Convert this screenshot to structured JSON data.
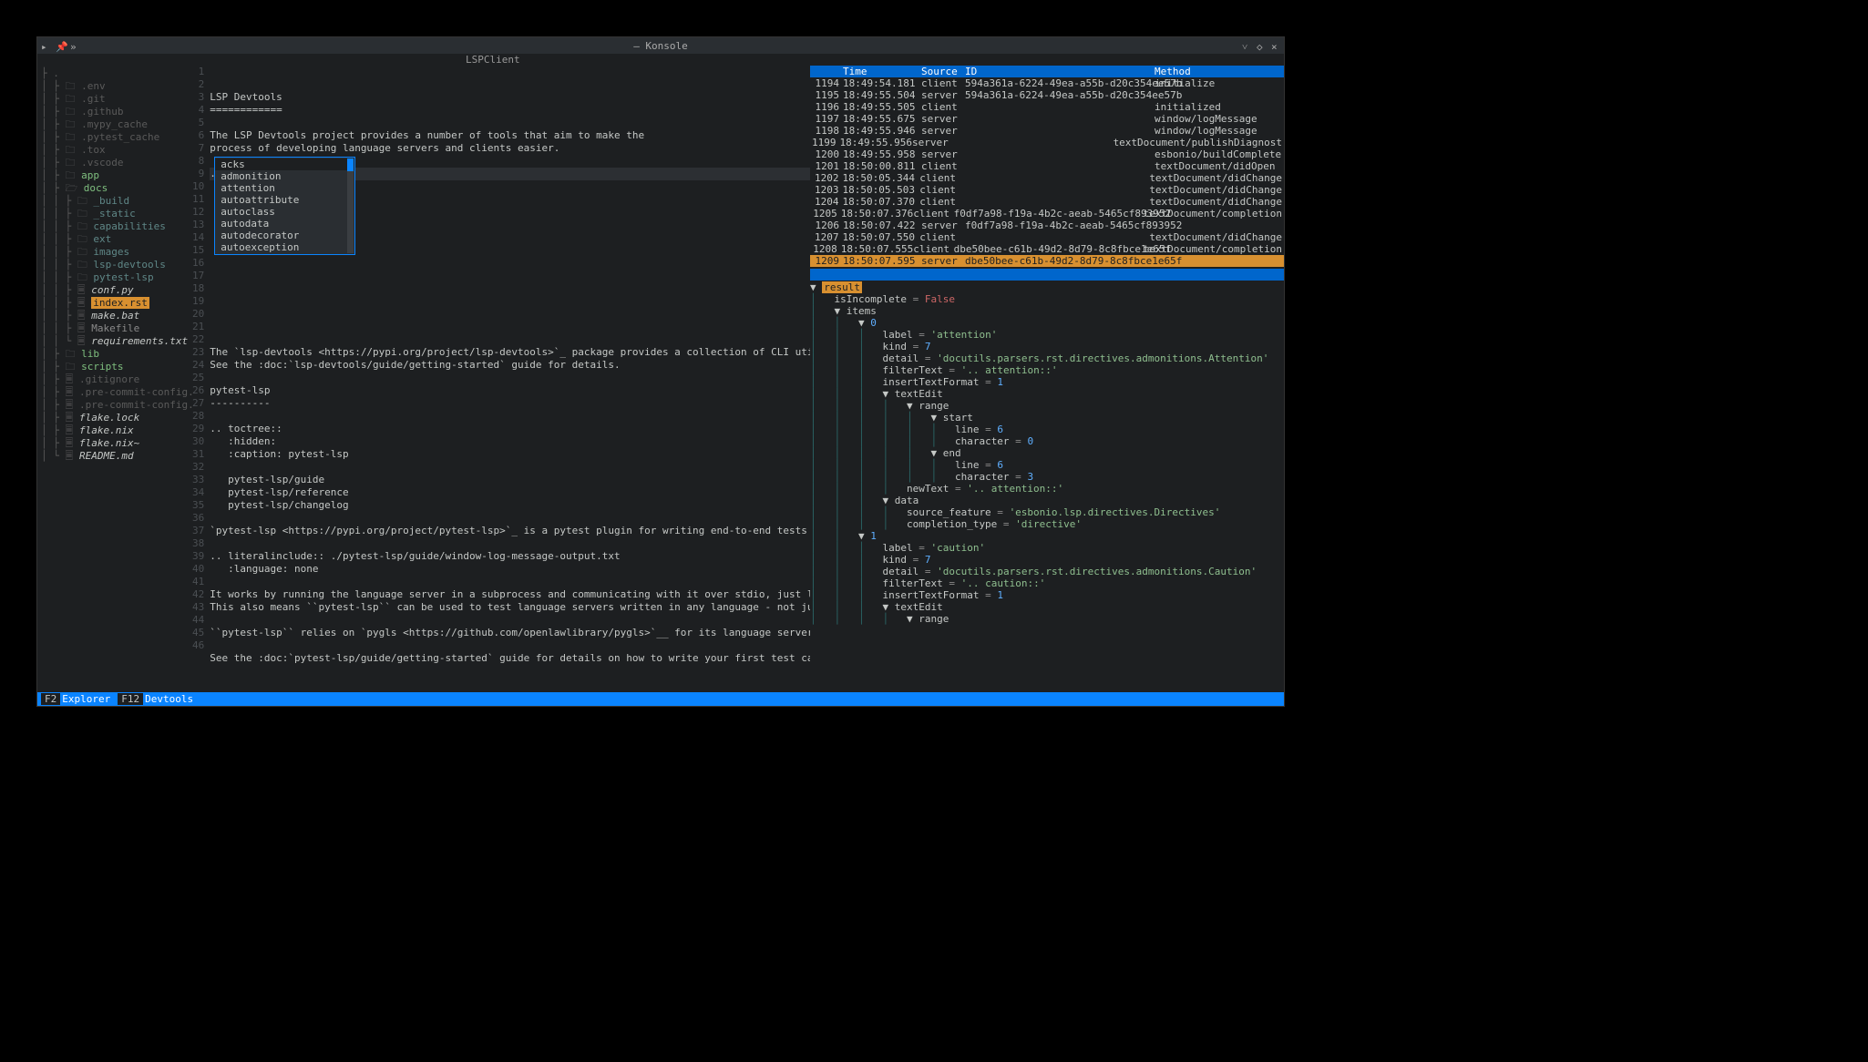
{
  "window": {
    "title": "— Konsole"
  },
  "tab": {
    "title": "LSPClient"
  },
  "sidebar": {
    "rows": [
      {
        "prefix": "├ ",
        "icon": "",
        "name": ".",
        "cls": "dim"
      },
      {
        "prefix": "│ ├ ",
        "icon": "🗀 ",
        "name": ".env",
        "cls": "dim"
      },
      {
        "prefix": "│ ├ ",
        "icon": "🗀 ",
        "name": ".git",
        "cls": "dim"
      },
      {
        "prefix": "│ ├ ",
        "icon": "🗀 ",
        "name": ".github",
        "cls": "dim"
      },
      {
        "prefix": "│ ├ ",
        "icon": "🗀 ",
        "name": ".mypy_cache",
        "cls": "dim"
      },
      {
        "prefix": "│ ├ ",
        "icon": "🗀 ",
        "name": ".pytest_cache",
        "cls": "dim"
      },
      {
        "prefix": "│ ├ ",
        "icon": "🗀 ",
        "name": ".tox",
        "cls": "dim"
      },
      {
        "prefix": "│ ├ ",
        "icon": "🗀 ",
        "name": ".vscode",
        "cls": "dim"
      },
      {
        "prefix": "│ ├ ",
        "icon": "🗀 ",
        "name": "app",
        "cls": "fg-green"
      },
      {
        "prefix": "│ ├ ",
        "icon": "🗁 ",
        "name": "docs",
        "cls": "fg-green"
      },
      {
        "prefix": "│ │ ├ ",
        "icon": "🗀 ",
        "name": "_build",
        "cls": "fg-cyan"
      },
      {
        "prefix": "│ │ ├ ",
        "icon": "🗀 ",
        "name": "_static",
        "cls": "fg-cyan"
      },
      {
        "prefix": "│ │ ├ ",
        "icon": "🗀 ",
        "name": "capabilities",
        "cls": "fg-cyan"
      },
      {
        "prefix": "│ │ ├ ",
        "icon": "🗀 ",
        "name": "ext",
        "cls": "fg-cyan"
      },
      {
        "prefix": "│ │ ├ ",
        "icon": "🗀 ",
        "name": "images",
        "cls": "fg-cyan"
      },
      {
        "prefix": "│ │ ├ ",
        "icon": "🗀 ",
        "name": "lsp-devtools",
        "cls": "fg-cyan"
      },
      {
        "prefix": "│ │ ├ ",
        "icon": "🗀 ",
        "name": "pytest-lsp",
        "cls": "fg-cyan"
      },
      {
        "prefix": "│ │ ├ ",
        "icon": "🗏 ",
        "name": "conf.py",
        "cls": "fg-emph"
      },
      {
        "prefix": "│ │ ├ ",
        "icon": "🗏 ",
        "name": "index.rst",
        "cls": "selected"
      },
      {
        "prefix": "│ │ ├ ",
        "icon": "🗏 ",
        "name": "make.bat",
        "cls": "fg-emph"
      },
      {
        "prefix": "│ │ ├ ",
        "icon": "🗏 ",
        "name": "Makefile",
        "cls": ""
      },
      {
        "prefix": "│ │ └ ",
        "icon": "🗏 ",
        "name": "requirements.txt",
        "cls": "fg-emph"
      },
      {
        "prefix": "│ ├ ",
        "icon": "🗀 ",
        "name": "lib",
        "cls": "fg-green"
      },
      {
        "prefix": "│ ├ ",
        "icon": "🗀 ",
        "name": "scripts",
        "cls": "fg-green"
      },
      {
        "prefix": "│ ├ ",
        "icon": "🗏 ",
        "name": ".gitignore",
        "cls": "dim"
      },
      {
        "prefix": "│ ├ ",
        "icon": "🗏 ",
        "name": ".pre-commit-config.yaml",
        "cls": "dim"
      },
      {
        "prefix": "│ ├ ",
        "icon": "🗏 ",
        "name": ".pre-commit-config.yaml",
        "cls": "dim"
      },
      {
        "prefix": "│ ├ ",
        "icon": "🗏 ",
        "name": "flake.lock",
        "cls": "fg-emph"
      },
      {
        "prefix": "│ ├ ",
        "icon": "🗏 ",
        "name": "flake.nix",
        "cls": "fg-emph"
      },
      {
        "prefix": "│ ├ ",
        "icon": "🗏 ",
        "name": "flake.nix~",
        "cls": "fg-emph"
      },
      {
        "prefix": "│ └ ",
        "icon": "🗏 ",
        "name": "README.md",
        "cls": "fg-emph"
      }
    ]
  },
  "editor": {
    "lines": [
      {
        "n": 1,
        "t": "LSP Devtools"
      },
      {
        "n": 2,
        "t": "============"
      },
      {
        "n": 3,
        "t": ""
      },
      {
        "n": 4,
        "t": "The LSP Devtools project provides a number of tools that aim to make the"
      },
      {
        "n": 5,
        "t": "process of developing language servers and clients easier."
      },
      {
        "n": 6,
        "t": ""
      },
      {
        "n": 7,
        "t": "..",
        "cursor": true
      },
      {
        "n": 8,
        "t": ""
      },
      {
        "n": 9,
        "t": ""
      },
      {
        "n": 10,
        "t": ""
      },
      {
        "n": 11,
        "t": ""
      },
      {
        "n": 12,
        "t": ""
      },
      {
        "n": 13,
        "t": ""
      },
      {
        "n": 14,
        "t": ""
      },
      {
        "n": 15,
        "t": ""
      },
      {
        "n": 16,
        "t": ""
      },
      {
        "n": 17,
        "t": ""
      },
      {
        "n": 18,
        "t": ""
      },
      {
        "n": 19,
        "t": ""
      },
      {
        "n": 20,
        "t": ""
      },
      {
        "n": 21,
        "t": "The `lsp-devtools <https://pypi.org/project/lsp-devtools>`_ package provides a collection of CLI utilities tha"
      },
      {
        "n": 22,
        "t": "See the :doc:`lsp-devtools/guide/getting-started` guide for details."
      },
      {
        "n": 23,
        "t": ""
      },
      {
        "n": 24,
        "t": "pytest-lsp"
      },
      {
        "n": 25,
        "t": "----------"
      },
      {
        "n": 26,
        "t": ""
      },
      {
        "n": 27,
        "t": ".. toctree::"
      },
      {
        "n": 28,
        "t": "   :hidden:"
      },
      {
        "n": 29,
        "t": "   :caption: pytest-lsp"
      },
      {
        "n": 30,
        "t": ""
      },
      {
        "n": 31,
        "t": "   pytest-lsp/guide"
      },
      {
        "n": 32,
        "t": "   pytest-lsp/reference"
      },
      {
        "n": 33,
        "t": "   pytest-lsp/changelog"
      },
      {
        "n": 34,
        "t": ""
      },
      {
        "n": 35,
        "t": "`pytest-lsp <https://pypi.org/project/pytest-lsp>`_ is a pytest plugin for writing end-to-end tests for langua"
      },
      {
        "n": 36,
        "t": ""
      },
      {
        "n": 37,
        "t": ".. literalinclude:: ./pytest-lsp/guide/window-log-message-output.txt"
      },
      {
        "n": 38,
        "t": "   :language: none"
      },
      {
        "n": 39,
        "t": ""
      },
      {
        "n": 40,
        "t": "It works by running the language server in a subprocess and communicating with it over stdio, just like a real"
      },
      {
        "n": 41,
        "t": "This also means ``pytest-lsp`` can be used to test language servers written in any language - not just Python."
      },
      {
        "n": 42,
        "t": ""
      },
      {
        "n": 43,
        "t": "``pytest-lsp`` relies on `pygls <https://github.com/openlawlibrary/pygls>`__ for its language server protocol"
      },
      {
        "n": 44,
        "t": ""
      },
      {
        "n": 45,
        "t": "See the :doc:`pytest-lsp/guide/getting-started` guide for details on how to write your first test case."
      },
      {
        "n": 46,
        "t": ""
      }
    ],
    "popup": [
      "acks",
      "admonition",
      "attention",
      "autoattribute",
      "autoclass",
      "autodata",
      "autodecorator",
      "autoexception"
    ]
  },
  "logs": {
    "headers": {
      "seq": "",
      "time": "Time",
      "source": "Source",
      "id": "ID",
      "method": "Method"
    },
    "rows": [
      {
        "seq": "1194",
        "time": "18:49:54.181",
        "src": "client",
        "id": "594a361a-6224-49ea-a55b-d20c354ee57b",
        "meth": "initialize"
      },
      {
        "seq": "1195",
        "time": "18:49:55.504",
        "src": "server",
        "id": "594a361a-6224-49ea-a55b-d20c354ee57b",
        "meth": ""
      },
      {
        "seq": "1196",
        "time": "18:49:55.505",
        "src": "client",
        "id": "",
        "meth": "initialized"
      },
      {
        "seq": "1197",
        "time": "18:49:55.675",
        "src": "server",
        "id": "",
        "meth": "window/logMessage"
      },
      {
        "seq": "1198",
        "time": "18:49:55.946",
        "src": "server",
        "id": "",
        "meth": "window/logMessage"
      },
      {
        "seq": "1199",
        "time": "18:49:55.956",
        "src": "server",
        "id": "",
        "meth": "textDocument/publishDiagnost"
      },
      {
        "seq": "1200",
        "time": "18:49:55.958",
        "src": "server",
        "id": "",
        "meth": "esbonio/buildComplete"
      },
      {
        "seq": "1201",
        "time": "18:50:00.811",
        "src": "client",
        "id": "",
        "meth": "textDocument/didOpen"
      },
      {
        "seq": "1202",
        "time": "18:50:05.344",
        "src": "client",
        "id": "",
        "meth": "textDocument/didChange"
      },
      {
        "seq": "1203",
        "time": "18:50:05.503",
        "src": "client",
        "id": "",
        "meth": "textDocument/didChange"
      },
      {
        "seq": "1204",
        "time": "18:50:07.370",
        "src": "client",
        "id": "",
        "meth": "textDocument/didChange"
      },
      {
        "seq": "1205",
        "time": "18:50:07.376",
        "src": "client",
        "id": "f0df7a98-f19a-4b2c-aeab-5465cf893952",
        "meth": "textDocument/completion"
      },
      {
        "seq": "1206",
        "time": "18:50:07.422",
        "src": "server",
        "id": "f0df7a98-f19a-4b2c-aeab-5465cf893952",
        "meth": ""
      },
      {
        "seq": "1207",
        "time": "18:50:07.550",
        "src": "client",
        "id": "",
        "meth": "textDocument/didChange"
      },
      {
        "seq": "1208",
        "time": "18:50:07.555",
        "src": "client",
        "id": "dbe50bee-c61b-49d2-8d79-8c8fbce1e65f",
        "meth": "textDocument/completion"
      },
      {
        "seq": "1209",
        "time": "18:50:07.595",
        "src": "server",
        "id": "dbe50bee-c61b-49d2-8d79-8c8fbce1e65f",
        "meth": "",
        "sel": true
      }
    ]
  },
  "inspector": {
    "rows": [
      {
        "ind": 0,
        "arrow": "▼ ",
        "keyhl": "result"
      },
      {
        "ind": 1,
        "key": "isIncomplete",
        "eq": " = ",
        "bool": "False"
      },
      {
        "ind": 1,
        "arrow": "▼ ",
        "key": "items"
      },
      {
        "ind": 2,
        "arrow": "▼ ",
        "num": "0"
      },
      {
        "ind": 3,
        "key": "label",
        "eq": " = ",
        "str": "'attention'"
      },
      {
        "ind": 3,
        "key": "kind",
        "eq": " = ",
        "num": "7"
      },
      {
        "ind": 3,
        "key": "detail",
        "eq": " = ",
        "str": "'docutils.parsers.rst.directives.admonitions.Attention'"
      },
      {
        "ind": 3,
        "key": "filterText",
        "eq": " = ",
        "str": "'.. attention::'"
      },
      {
        "ind": 3,
        "key": "insertTextFormat",
        "eq": " = ",
        "num": "1"
      },
      {
        "ind": 3,
        "arrow": "▼ ",
        "key": "textEdit"
      },
      {
        "ind": 4,
        "arrow": "▼ ",
        "key": "range"
      },
      {
        "ind": 5,
        "arrow": "▼ ",
        "key": "start"
      },
      {
        "ind": 6,
        "key": "line",
        "eq": " = ",
        "num": "6"
      },
      {
        "ind": 6,
        "key": "character",
        "eq": " = ",
        "num": "0"
      },
      {
        "ind": 5,
        "arrow": "▼ ",
        "key": "end"
      },
      {
        "ind": 6,
        "key": "line",
        "eq": " = ",
        "num": "6"
      },
      {
        "ind": 6,
        "key": "character",
        "eq": " = ",
        "num": "3"
      },
      {
        "ind": 4,
        "key": "newText",
        "eq": " = ",
        "str": "'.. attention::'"
      },
      {
        "ind": 3,
        "arrow": "▼ ",
        "key": "data"
      },
      {
        "ind": 4,
        "key": "source_feature",
        "eq": " = ",
        "str": "'esbonio.lsp.directives.Directives'"
      },
      {
        "ind": 4,
        "key": "completion_type",
        "eq": " = ",
        "str": "'directive'"
      },
      {
        "ind": 2,
        "arrow": "▼ ",
        "num": "1"
      },
      {
        "ind": 3,
        "key": "label",
        "eq": " = ",
        "str": "'caution'"
      },
      {
        "ind": 3,
        "key": "kind",
        "eq": " = ",
        "num": "7"
      },
      {
        "ind": 3,
        "key": "detail",
        "eq": " = ",
        "str": "'docutils.parsers.rst.directives.admonitions.Caution'"
      },
      {
        "ind": 3,
        "key": "filterText",
        "eq": " = ",
        "str": "'.. caution::'"
      },
      {
        "ind": 3,
        "key": "insertTextFormat",
        "eq": " = ",
        "num": "1"
      },
      {
        "ind": 3,
        "arrow": "▼ ",
        "key": "textEdit"
      },
      {
        "ind": 4,
        "arrow": "▼ ",
        "key": "range"
      }
    ]
  },
  "status": {
    "f2": "F2",
    "explorer": "Explorer",
    "f12": "F12",
    "devtools": "Devtools"
  }
}
